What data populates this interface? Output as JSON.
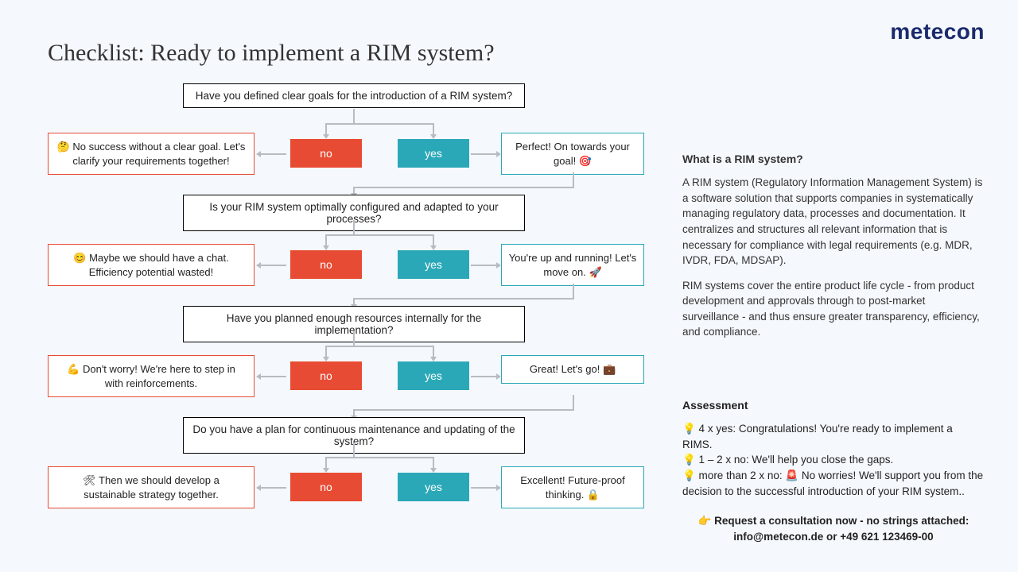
{
  "logo": "metecon",
  "title": "Checklist: Ready to implement a RIM system?",
  "labels": {
    "no": "no",
    "yes": "yes"
  },
  "questions": [
    {
      "q": "Have you defined clear goals for the introduction of a RIM system?",
      "no": "🤔 No success without a clear goal. Let's clarify your requirements together!",
      "yes": "Perfect! On towards your goal! 🎯"
    },
    {
      "q": "Is your RIM system optimally configured and adapted to your processes?",
      "no": "😊 Maybe we should have a chat. Efficiency potential wasted!",
      "yes": "You're up and running! Let's move on. 🚀"
    },
    {
      "q": "Have you planned enough resources internally for the implementation?",
      "no": "💪 Don't worry! We're here to step in with reinforcements.",
      "yes": "Great! Let's go! 💼"
    },
    {
      "q": "Do you have a plan for continuous maintenance and updating of the system?",
      "no": "🛠 Then we should develop a sustainable strategy together.",
      "yes": "Excellent! Future-proof thinking. 🔒"
    }
  ],
  "sidebar": {
    "heading": "What is a RIM system?",
    "p1": "A RIM system (Regulatory Information Management System) is a software solution that supports companies in systematically managing regulatory data, processes and documentation. It centralizes and structures all relevant information that is necessary for compliance with legal requirements (e.g. MDR, IVDR, FDA, MDSAP).",
    "p2": "RIM systems cover the entire product life cycle - from product development and approvals through to post-market surveillance - and thus ensure greater transparency, efficiency, and compliance."
  },
  "assessment": {
    "heading": "Assessment",
    "l1": "💡 4 x yes: Congratulations! You're ready to implement a RIMS.",
    "l2": "💡 1 – 2 x no: We'll help you close the gaps.",
    "l3": "💡 more than 2 x no: 🚨 No worries! We'll support you from the decision to the successful introduction of your RIM system..",
    "cta1": "👉 Request a consultation now - no strings attached:",
    "cta2": "info@metecon.de or +49 621 123469-00"
  }
}
